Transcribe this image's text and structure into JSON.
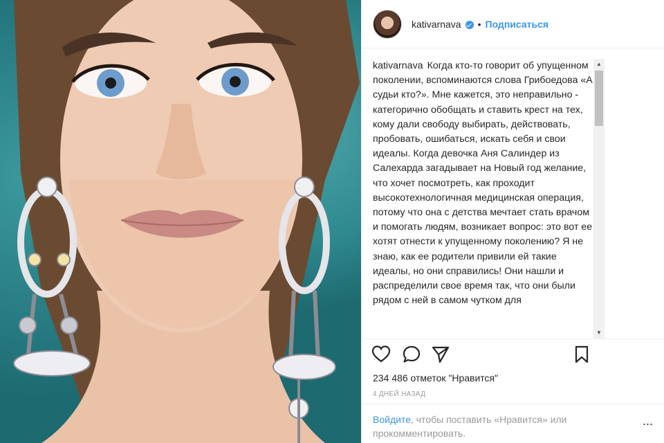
{
  "post": {
    "username": "kativarnava",
    "verified_icon": "verified-badge-icon",
    "separator": "•",
    "follow_label": "Подписаться",
    "caption_user": "kativarnava",
    "caption_text": "Когда кто-то говорит об упущенном поколении, вспоминаются слова Грибоедова «А судьи кто?». Мне кажется, это неправильно - категорично обобщать и ставить крест на тех, кому дали свободу выбирать, действовать, пробовать, ошибаться, искать себя и свои идеалы. Когда девочка Аня Салиндер из Салехарда загадывает на Новый год желание, что хочет посмотреть, как проходит высокотехнологичная медицинская операция, потому что она с детства мечтает стать врачом и помогать людям, возникает вопрос: это вот ее хотят отнести к упущенному поколению? Я не знаю, как ее родители привили ей такие идеалы, но они справились! Они нашли и распределили свое время так, что они были рядом с ней в самом чутком для",
    "likes": "234 486 отметок \"Нравится\"",
    "timestamp": "4 ДНЕЙ НАЗАД",
    "login_link": "Войдите",
    "login_text": ", чтобы поставить «Нравится» или прокомментировать.",
    "more_label": "..."
  },
  "icons": {
    "like": "heart-icon",
    "comment": "comment-icon",
    "share": "share-icon",
    "save": "bookmark-icon"
  },
  "colors": {
    "accent": "#3897f0",
    "text": "#262626",
    "muted": "#999999",
    "photo_background": "#2f8a90"
  }
}
